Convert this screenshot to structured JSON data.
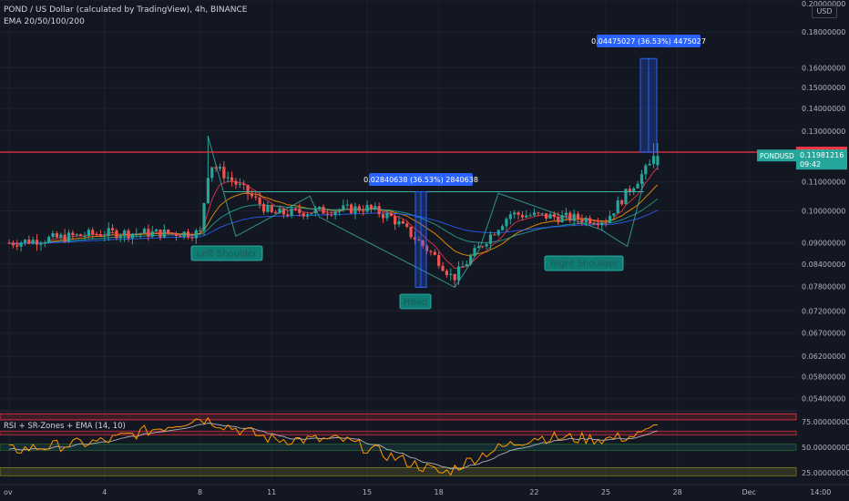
{
  "header": {
    "title": "POND / US Dollar (calculated by TradingView), 4h, BINANCE",
    "indicator": "EMA 20/50/100/200",
    "currency": "USD"
  },
  "colors": {
    "background": "#131722",
    "grid": "#1e2230",
    "up": "#26a69a",
    "down": "#ef5350",
    "resistance": "#f23645",
    "measure": "#2962ff",
    "neckline": "#3bb3a8",
    "label_bg": "#0f7d74",
    "ema_20": "#f23645",
    "ema_50": "#ff9800",
    "ema_100": "#26a69a",
    "ema_200": "#2962ff",
    "rsi": "#ff9800",
    "rsi_ema": "#d1d4dc"
  },
  "price_axis": {
    "ticks": [
      "0.20000000",
      "0.18000000",
      "0.16000000",
      "0.15000000",
      "0.14000000",
      "0.13000000",
      "0.11000000",
      "0.10000000",
      "0.09000000",
      "0.08400000",
      "0.07800000",
      "0.07200000",
      "0.06700000",
      "0.06200000",
      "0.05800000",
      "0.05400000"
    ],
    "resistance_label": "0.12130649",
    "symbol_label": "PONDUSD",
    "current_price": "0.11981216",
    "countdown": "09:42"
  },
  "time_axis": {
    "ticks": [
      "ov",
      "4",
      "8",
      "11",
      "15",
      "18",
      "22",
      "25",
      "28",
      "Dec",
      "14:00"
    ]
  },
  "annotations": {
    "left_shoulder": "Left Shoulder",
    "head": "Head",
    "right_shoulder": "Right Shoulder",
    "measure_1": "0.02840638 (36.53%) 2840638",
    "measure_2": "0.04475027 (36.53%) 4475027"
  },
  "rsi": {
    "title": "RSI + SR-Zones + EMA (14, 10)",
    "ticks": [
      "75.00000000",
      "50.00000000",
      "25.00000000"
    ]
  },
  "chart_data": [
    {
      "type": "candlestick",
      "title": "POND / US Dollar (calculated by TradingView), 4h, BINANCE",
      "x": [
        "ov",
        "4",
        "8",
        "11",
        "15",
        "18",
        "22",
        "25",
        "28"
      ],
      "close": [
        0.09,
        0.093,
        0.093,
        0.117,
        0.099,
        0.101,
        0.098,
        0.085,
        0.08,
        0.099,
        0.097,
        0.1198
      ],
      "x_points": [
        0,
        4,
        8,
        8.4,
        11,
        15,
        16,
        18,
        18.6,
        21,
        25,
        27.2
      ],
      "resistance": 0.12130649,
      "current": 0.11981216,
      "ylim": [
        0.05,
        0.2
      ],
      "log_scale": true,
      "pattern": [
        "Left Shoulder",
        "Head",
        "Right Shoulder"
      ]
    },
    {
      "type": "line",
      "title": "RSI + SR-Zones + EMA (14, 10)",
      "x": [
        0,
        4,
        8,
        11,
        14,
        16,
        18.2,
        20,
        22,
        25,
        26.5,
        27.2
      ],
      "series": [
        {
          "values": [
            47,
            56,
            79,
            58,
            57,
            41,
            24,
            45,
            60,
            58,
            62,
            72
          ]
        }
      ],
      "ylim": [
        15,
        85
      ]
    }
  ]
}
